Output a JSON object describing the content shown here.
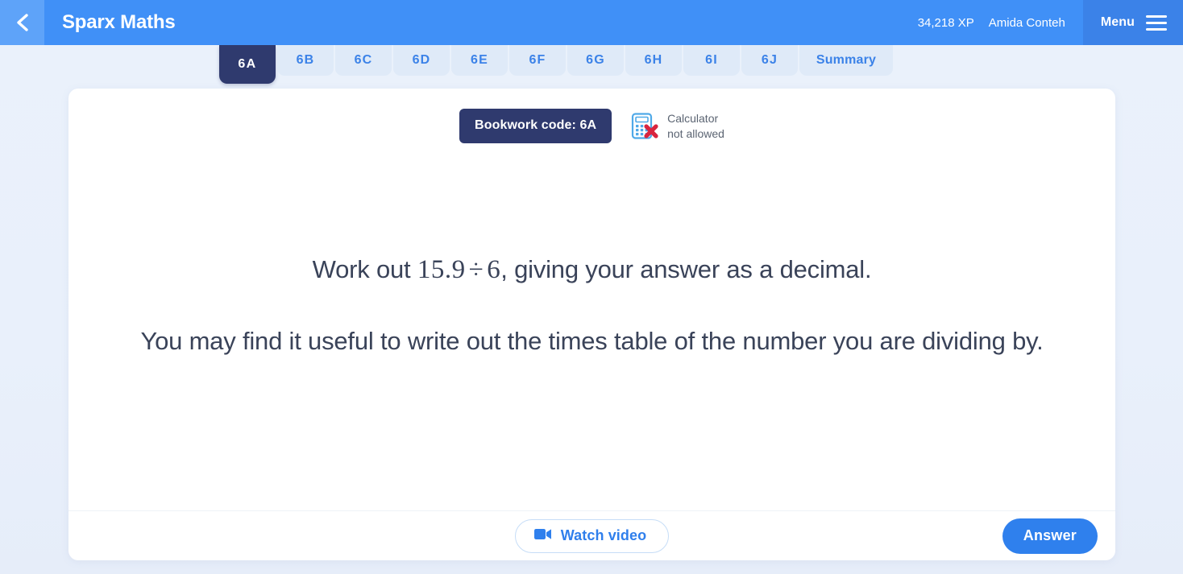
{
  "header": {
    "back_icon": "chevron-left-icon",
    "brand": "Sparx Maths",
    "xp": "34,218 XP",
    "username": "Amida Conteh",
    "menu_label": "Menu",
    "menu_icon": "hamburger-icon",
    "bg_color": "#4090f7",
    "menu_bg_color": "#3b82e8"
  },
  "tabs": {
    "active_index": 0,
    "items": [
      {
        "label": "6A",
        "active": true
      },
      {
        "label": "6B",
        "active": false
      },
      {
        "label": "6C",
        "active": false
      },
      {
        "label": "6D",
        "active": false
      },
      {
        "label": "6E",
        "active": false
      },
      {
        "label": "6F",
        "active": false
      },
      {
        "label": "6G",
        "active": false
      },
      {
        "label": "6H",
        "active": false
      },
      {
        "label": "6I",
        "active": false
      },
      {
        "label": "6J",
        "active": false
      },
      {
        "label": "Summary",
        "active": false
      }
    ],
    "active_bg_color": "#2f3a6e",
    "inactive_bg_color": "#dfeaf8",
    "inactive_text_color": "#3b82e8"
  },
  "question_card": {
    "bookwork_code": "Bookwork code: 6A",
    "bookwork_bg_color": "#2f3a6e",
    "calculator": {
      "icon": "calculator-not-allowed-icon",
      "line1": "Calculator",
      "line2": "not allowed"
    },
    "question": {
      "prefix": "Work out ",
      "math_a": "15.9",
      "math_op": "÷",
      "math_b": "6",
      "suffix": ", giving your answer as a decimal.",
      "hint": "You may find it useful to write out the times table of the number you are dividing by."
    },
    "footer": {
      "watch_video_label": "Watch video",
      "watch_video_icon": "video-camera-icon",
      "answer_label": "Answer",
      "answer_bg_color": "#2f80ed"
    }
  },
  "page": {
    "background_color": "#eaf0fb"
  }
}
